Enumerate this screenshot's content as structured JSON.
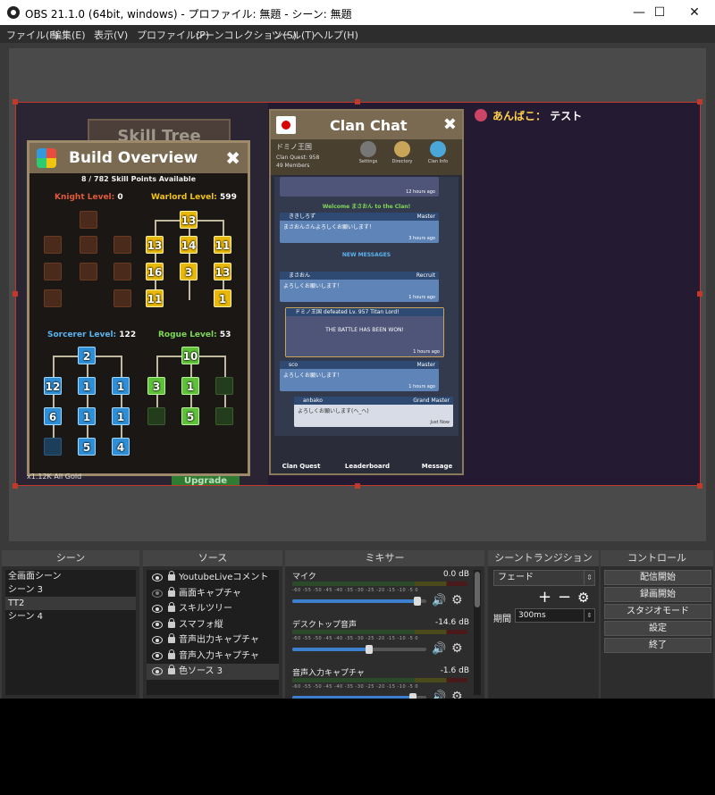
{
  "window": {
    "title": "OBS 21.1.0 (64bit, windows) - プロファイル: 無題 - シーン: 無題",
    "minimize": "—",
    "maximize": "☐",
    "close": "✕"
  },
  "menu": [
    "ファイル(F)",
    "編集(E)",
    "表示(V)",
    "プロファイル(P)",
    "シーンコレクション(S)",
    "ツール(T)",
    "ヘルプ(H)"
  ],
  "preview": {
    "skill_tree_title": "Skill Tree",
    "build": {
      "title": "Build Overview",
      "skill_points": "8 / 782 Skill Points Available",
      "knight_label": "Knight Level:",
      "knight_value": "0",
      "warlord_label": "Warlord Level:",
      "warlord_value": "599",
      "sorcerer_label": "Sorcerer Level:",
      "sorcerer_value": "122",
      "rogue_label": "Rogue Level:",
      "rogue_value": "53",
      "warlord_nodes": [
        "13",
        "13",
        "14",
        "11",
        "16",
        "3",
        "13",
        "11",
        "1"
      ],
      "sorcerer_nodes": [
        "2",
        "12",
        "1",
        "1",
        "6",
        "1",
        "1",
        "5",
        "4"
      ],
      "rogue_nodes": [
        "10",
        "3",
        "1",
        "5"
      ],
      "gold": "x1.12K All Gold",
      "upgrade": "Upgrade"
    },
    "clan": {
      "title": "Clan Chat",
      "name": "ドミノ王国",
      "quest": "Clan Quest: 958",
      "members": "49 Members",
      "settings": "Settings",
      "directory": "Directory",
      "clan_info": "Clan Info",
      "ts1": "12 hours ago",
      "welcome": "Welcome まさおん to the Clan!",
      "m1_user": "ききしろず",
      "m1_rank": "Master",
      "m1_text": "まさおんさんよろしくお願いします！",
      "m1_time": "3 hours ago",
      "new_messages": "NEW MESSAGES",
      "m2_user": "まさおん",
      "m2_rank": "Recruit",
      "m2_text": "よろしくお願いします！",
      "m2_time": "1 hours ago",
      "m3_head": "ドミノ王国 defeated Lv. 957 Titan Lord!",
      "m3_text": "THE BATTLE HAS BEEN WON!",
      "m3_time": "1 hours ago",
      "m4_user": "sco",
      "m4_rank": "Master",
      "m4_text": "よろしくお願いします！",
      "m4_time": "1 hours ago",
      "m5_user": "anbako",
      "m5_rank": "Grand Master",
      "m5_text": "よろしくお願いします(ヘ_ヘ)",
      "m5_time": "Just Now",
      "tab_quest": "Clan Quest",
      "tab_leader": "Leaderboard",
      "tab_message": "Message"
    },
    "chat_user": "あんばこ：",
    "chat_text": "テスト"
  },
  "docks": {
    "scenes_header": "シーン",
    "scenes": [
      "全画面シーン",
      "シーン 3",
      "TT2",
      "シーン 4"
    ],
    "sources_header": "ソース",
    "sources": [
      "YoutubeLiveコメント",
      "画面キャプチャ",
      "スキルツリー",
      "スマフォ縦",
      "音声出力キャプチャ",
      "音声入力キャプチャ",
      "色ソース 3"
    ],
    "mixer_header": "ミキサー",
    "mixer": [
      {
        "name": "マイク",
        "db": "0.0 dB",
        "level": 0.93
      },
      {
        "name": "デスクトップ音声",
        "db": "-14.6 dB",
        "level": 0.57
      },
      {
        "name": "音声入力キャプチャ",
        "db": "-1.6 dB",
        "level": 0.9
      }
    ],
    "meter_ticks": "-60  -55  -50  -45  -40  -35  -30  -25  -20  -15  -10   -5   0",
    "transitions_header": "シーントランジション",
    "transition": "フェード",
    "duration_label": "期間",
    "duration_value": "300ms",
    "controls_header": "コントロール",
    "controls": [
      "配信開始",
      "録画開始",
      "スタジオモード",
      "設定",
      "終了"
    ]
  }
}
